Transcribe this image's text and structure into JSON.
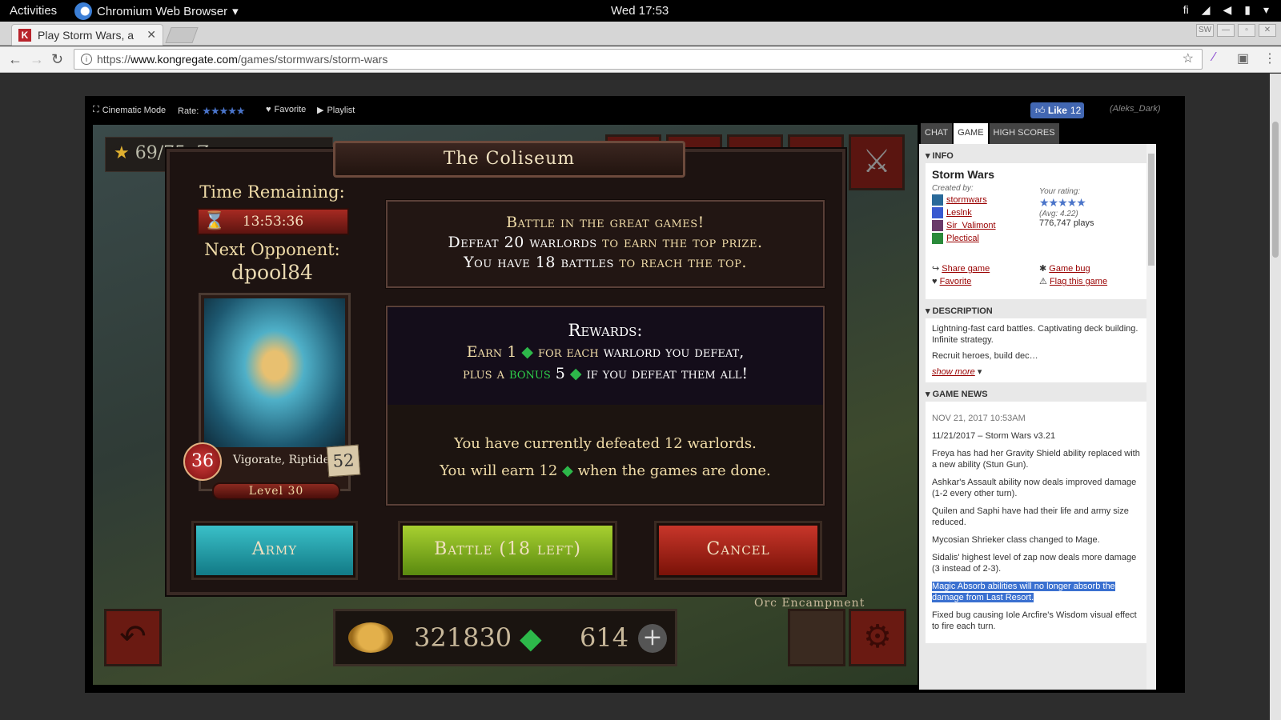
{
  "system": {
    "activities": "Activities",
    "app_name": "Chromium Web Browser",
    "clock": "Wed 17:53",
    "lang": "fi"
  },
  "browser": {
    "tab_title": "Play Storm Wars, a",
    "url_prefix": "https://",
    "url_domain": "www.kongregate.com",
    "url_path": "/games/stormwars/storm-wars",
    "profile_badge": "SW"
  },
  "kong_bar": {
    "cinematic": "Cinematic Mode",
    "rate": "Rate:",
    "favorite": "Favorite",
    "playlist": "Playlist",
    "like": "Like",
    "like_count": "12",
    "username": "(Aleks_Dark)"
  },
  "game": {
    "stars": "69/75",
    "zoom": "Zoom:",
    "gold": "321830",
    "gems": "614",
    "location": "Orc Encampment",
    "modal": {
      "title": "The Coliseum",
      "time_label": "Time Remaining:",
      "time_value": "13:53:36",
      "next_label": "Next Opponent:",
      "opponent": "dpool84",
      "card_health": "36",
      "card_name": "Vigorate, Riptide",
      "card_cost": "52",
      "card_level": "Level 30",
      "intro_l1": "Battle in the great games!",
      "intro_l2a": "Defeat 20 warlords",
      "intro_l2b": " to earn the top prize.",
      "intro_l3a": "You have 18 battles",
      "intro_l3b": " to reach the top.",
      "rewards_title": "Rewards:",
      "rewards_l1a": "Earn 1",
      "rewards_l1b": "for each",
      "rewards_l1c": "warlord you defeat,",
      "rewards_l2a": "plus a",
      "rewards_bonus": "bonus",
      "rewards_l2b": "5",
      "rewards_l2c": "if you defeat them all!",
      "status_l1": "You have currently defeated 12 warlords.",
      "status_l2a": "You will earn 12",
      "status_l2b": "when the games are done.",
      "army_btn": "Army",
      "battle_btn": "Battle (18 left)",
      "cancel_btn": "Cancel"
    }
  },
  "sidebar": {
    "tabs": [
      "CHAT",
      "GAME",
      "HIGH SCORES"
    ],
    "info_header": "INFO",
    "game_title": "Storm Wars",
    "created_by": "Created by:",
    "your_rating": "Your rating:",
    "avg": "(Avg: 4.22)",
    "plays": "776,747 plays",
    "creators": [
      "stormwars",
      "Leslnk",
      "Sir_Valimont",
      "Plectical"
    ],
    "share": "Share game",
    "game_bug": "Game bug",
    "favorite": "Favorite",
    "flag": "Flag this game",
    "desc_header": "DESCRIPTION",
    "desc1": "Lightning-fast card battles. Captivating deck building. Infinite strategy.",
    "desc2": "Recruit heroes, build dec…",
    "show_more": "show more",
    "news_header": "GAME NEWS",
    "news_date": "NOV 21, 2017 10:53AM",
    "news_version": "11/21/2017 – Storm Wars v3.21",
    "news": [
      "Freya has had her Gravity Shield ability replaced with a new ability (Stun Gun).",
      "Ashkar's Assault ability now deals improved damage (1-2 every other turn).",
      "Quilen and Saphi have had their life and army size reduced.",
      "Mycosian Shrieker class changed to Mage.",
      "Sidalis' highest level of zap now deals more damage (3 instead of 2-3)."
    ],
    "news_highlight": "Magic Absorb abilities will no longer absorb the damage from Last Resort.",
    "news_last": "Fixed bug causing Iole Arcfire's Wisdom visual effect to fire each turn."
  }
}
